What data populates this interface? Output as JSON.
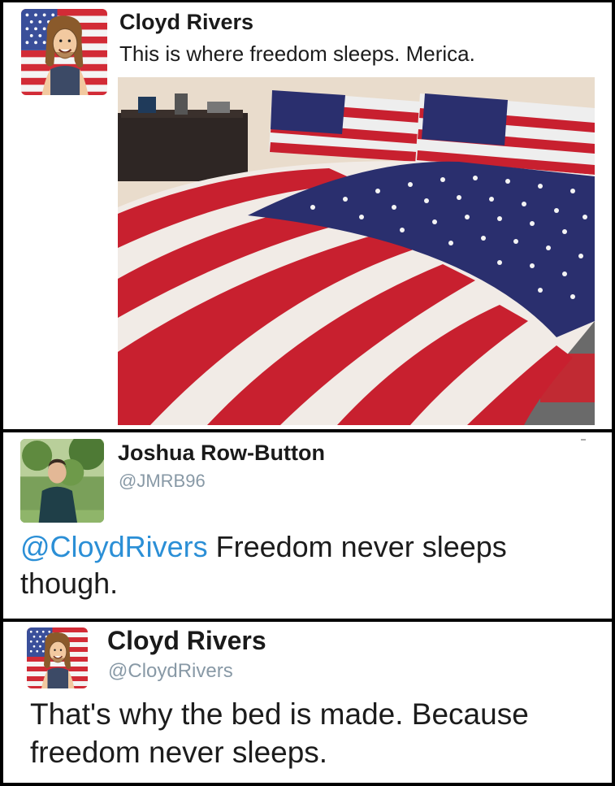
{
  "tweet1": {
    "author_name": "Cloyd Rivers",
    "text": "This is where freedom sleeps. Merica.",
    "avatar_icon": "flag-caricature-avatar-icon",
    "photo_subject": "bed-with-american-flag-bedding-image"
  },
  "reply1": {
    "author_name": "Joshua Row-Button",
    "handle": "@JMRB96",
    "mention": "@CloydRivers",
    "text": " Freedom never sleeps though.",
    "avatar_icon": "person-photo-avatar-icon"
  },
  "reply2": {
    "author_name": "Cloyd Rivers",
    "handle": "@CloydRivers",
    "text": "That's why the bed is made. Because freedom never sleeps.",
    "avatar_icon": "flag-caricature-avatar-icon"
  },
  "colors": {
    "mention": "#2b8fd6",
    "handle": "#8899a6",
    "flag_red": "#c8202f",
    "flag_blue": "#2a2f6e"
  }
}
